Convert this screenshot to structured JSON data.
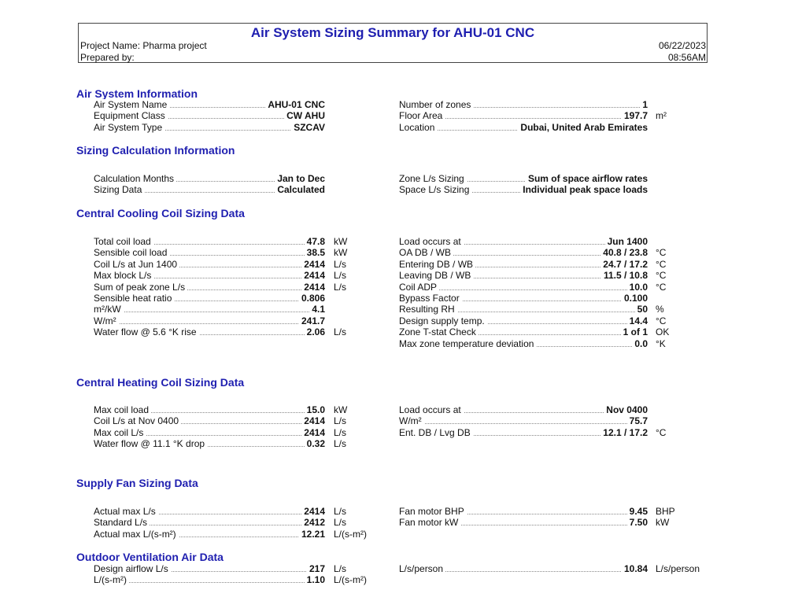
{
  "header": {
    "title": "Air System Sizing Summary for AHU-01 CNC",
    "project_name": "Project Name: Pharma project",
    "prepared_by": "Prepared by:",
    "date": "06/22/2023",
    "time": "08:56AM",
    "title_color": "#1f1fb0"
  },
  "air_system_information": {
    "title": "Air System Information",
    "left": [
      {
        "label": "Air System Name",
        "value": "AHU-01 CNC",
        "unit": ""
      },
      {
        "label": "Equipment Class",
        "value": "CW AHU",
        "unit": ""
      },
      {
        "label": "Air System Type",
        "value": "SZCAV",
        "unit": ""
      }
    ],
    "right": [
      {
        "label": "Number of zones",
        "value": "1",
        "unit": ""
      },
      {
        "label": "Floor Area",
        "value": "197.7",
        "unit": "m²"
      },
      {
        "label": "Location",
        "value": "Dubai, United Arab Emirates",
        "unit": ""
      }
    ]
  },
  "sizing_calculation_information": {
    "title": "Sizing Calculation Information",
    "left": [
      {
        "label": "Calculation Months",
        "value": "Jan to Dec",
        "unit": ""
      },
      {
        "label": "Sizing Data",
        "value": "Calculated",
        "unit": ""
      }
    ],
    "right": [
      {
        "label": "Zone L/s Sizing",
        "value": "Sum of space airflow rates",
        "unit": ""
      },
      {
        "label": "Space L/s Sizing",
        "value": "Individual peak space loads",
        "unit": ""
      }
    ]
  },
  "central_cooling_coil": {
    "title": "Central Cooling Coil Sizing Data",
    "left": [
      {
        "label": "Total coil load",
        "value": "47.8",
        "unit": "kW"
      },
      {
        "label": "Sensible coil load",
        "value": "38.5",
        "unit": "kW"
      },
      {
        "label": "Coil L/s at Jun 1400",
        "value": "2414",
        "unit": "L/s"
      },
      {
        "label": "Max block L/s",
        "value": "2414",
        "unit": "L/s"
      },
      {
        "label": "Sum of peak zone L/s",
        "value": "2414",
        "unit": "L/s"
      },
      {
        "label": "Sensible heat ratio",
        "value": "0.806",
        "unit": ""
      },
      {
        "label": "m²/kW",
        "value": "4.1",
        "unit": ""
      },
      {
        "label": "W/m²",
        "value": "241.7",
        "unit": ""
      },
      {
        "label": "Water flow @ 5.6 °K rise",
        "value": "2.06",
        "unit": "L/s"
      }
    ],
    "right": [
      {
        "label": "Load occurs at",
        "value": "Jun 1400",
        "unit": ""
      },
      {
        "label": "OA DB / WB",
        "value": "40.8 / 23.8",
        "unit": "°C"
      },
      {
        "label": "Entering DB / WB",
        "value": "24.7 / 17.2",
        "unit": "°C"
      },
      {
        "label": "Leaving DB / WB",
        "value": "11.5 / 10.8",
        "unit": "°C"
      },
      {
        "label": "Coil ADP",
        "value": "10.0",
        "unit": "°C"
      },
      {
        "label": "Bypass Factor",
        "value": "0.100",
        "unit": ""
      },
      {
        "label": "Resulting RH",
        "value": "50",
        "unit": "%"
      },
      {
        "label": "Design supply temp.",
        "value": "14.4",
        "unit": "°C"
      },
      {
        "label": "Zone T-stat Check",
        "value": "1 of 1",
        "unit": "OK"
      },
      {
        "label": "Max zone temperature deviation",
        "value": "0.0",
        "unit": "°K"
      }
    ]
  },
  "central_heating_coil": {
    "title": "Central Heating Coil Sizing Data",
    "left": [
      {
        "label": "Max coil load",
        "value": "15.0",
        "unit": "kW"
      },
      {
        "label": "Coil L/s at Nov 0400",
        "value": "2414",
        "unit": "L/s"
      },
      {
        "label": "Max coil L/s",
        "value": "2414",
        "unit": "L/s"
      },
      {
        "label": "Water flow @ 11.1 °K drop",
        "value": "0.32",
        "unit": "L/s"
      }
    ],
    "right": [
      {
        "label": "Load occurs at",
        "value": "Nov 0400",
        "unit": ""
      },
      {
        "label": "W/m²",
        "value": "75.7",
        "unit": ""
      },
      {
        "label": "Ent. DB / Lvg DB",
        "value": "12.1 / 17.2",
        "unit": "°C"
      }
    ]
  },
  "supply_fan": {
    "title": "Supply Fan Sizing Data",
    "left": [
      {
        "label": "Actual max L/s",
        "value": "2414",
        "unit": "L/s"
      },
      {
        "label": "Standard L/s",
        "value": "2412",
        "unit": "L/s"
      },
      {
        "label": "Actual max L/(s-m²)",
        "value": "12.21",
        "unit": "L/(s-m²)"
      }
    ],
    "right": [
      {
        "label": "Fan motor BHP",
        "value": "9.45",
        "unit": "BHP"
      },
      {
        "label": "Fan motor kW",
        "value": "7.50",
        "unit": "kW"
      }
    ]
  },
  "outdoor_ventilation": {
    "title": "Outdoor Ventilation Air Data",
    "left": [
      {
        "label": "Design airflow L/s",
        "value": "217",
        "unit": "L/s"
      },
      {
        "label": "L/(s-m²)",
        "value": "1.10",
        "unit": "L/(s-m²)"
      }
    ],
    "right": [
      {
        "label": "L/s/person",
        "value": "10.84",
        "unit": "L/s/person"
      }
    ]
  }
}
